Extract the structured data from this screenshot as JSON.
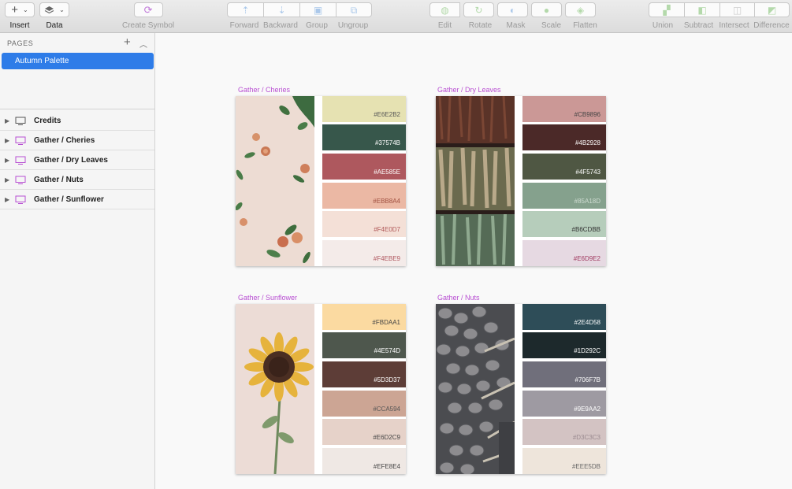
{
  "toolbar": {
    "insert_label": "Insert",
    "data_label": "Data",
    "create_symbol_label": "Create Symbol",
    "arrange": [
      "Forward",
      "Backward",
      "Group",
      "Ungroup"
    ],
    "edit_tools": [
      "Edit",
      "Rotate",
      "Mask",
      "Scale",
      "Flatten"
    ],
    "boolean_ops": [
      "Union",
      "Subtract",
      "Intersect",
      "Difference"
    ]
  },
  "sidebar": {
    "pages_header": "PAGES",
    "active_page": "Autumn Palette",
    "layers": [
      "Credits",
      "Gather / Cheries",
      "Gather / Dry Leaves",
      "Gather / Nuts",
      "Gather / Sunflower"
    ]
  },
  "artboards": [
    {
      "title": "Gather / Cheries",
      "swatches": [
        {
          "hex": "#E6E2B2",
          "text_color": "#555555"
        },
        {
          "hex": "#37574B",
          "text_color": "#ffffff"
        },
        {
          "hex": "#AE585E",
          "text_color": "#ffffff"
        },
        {
          "hex": "#EBB8A4",
          "text_color": "#a05040"
        },
        {
          "hex": "#F4E0D7",
          "text_color": "#b05858"
        },
        {
          "hex": "#F4EBE9",
          "text_color": "#b05860"
        }
      ]
    },
    {
      "title": "Gather / Dry Leaves",
      "swatches": [
        {
          "hex": "#CB9896",
          "text_color": "#444444"
        },
        {
          "hex": "#4B2928",
          "text_color": "#ffffff"
        },
        {
          "hex": "#4F5743",
          "text_color": "#ffffff"
        },
        {
          "hex": "#85A18D",
          "text_color": "#cfdcd2"
        },
        {
          "hex": "#B6CDBB",
          "text_color": "#333333"
        },
        {
          "hex": "#E6D9E2",
          "text_color": "#a03a60"
        }
      ]
    },
    {
      "title": "Gather / Sunflower",
      "swatches": [
        {
          "hex": "#FBDAA1",
          "text_color": "#444444"
        },
        {
          "hex": "#4E574D",
          "text_color": "#ffffff"
        },
        {
          "hex": "#5D3D37",
          "text_color": "#ffffff"
        },
        {
          "hex": "#CCA594",
          "text_color": "#555555"
        },
        {
          "hex": "#E6D2C9",
          "text_color": "#444444"
        },
        {
          "hex": "#EFE8E4",
          "text_color": "#444444"
        }
      ]
    },
    {
      "title": "Gather / Nuts",
      "swatches": [
        {
          "hex": "#2E4D58",
          "text_color": "#ffffff"
        },
        {
          "hex": "#1D292C",
          "text_color": "#ffffff"
        },
        {
          "hex": "#706F7B",
          "text_color": "#ffffff"
        },
        {
          "hex": "#9E9AA2",
          "text_color": "#ffffff"
        },
        {
          "hex": "#D3C3C3",
          "text_color": "#9a8a90"
        },
        {
          "hex": "#EEE5DB",
          "text_color": "#666666"
        }
      ]
    }
  ],
  "colors": {
    "accent": "#2E7CE8",
    "artboard_title": "#B84FD2"
  }
}
